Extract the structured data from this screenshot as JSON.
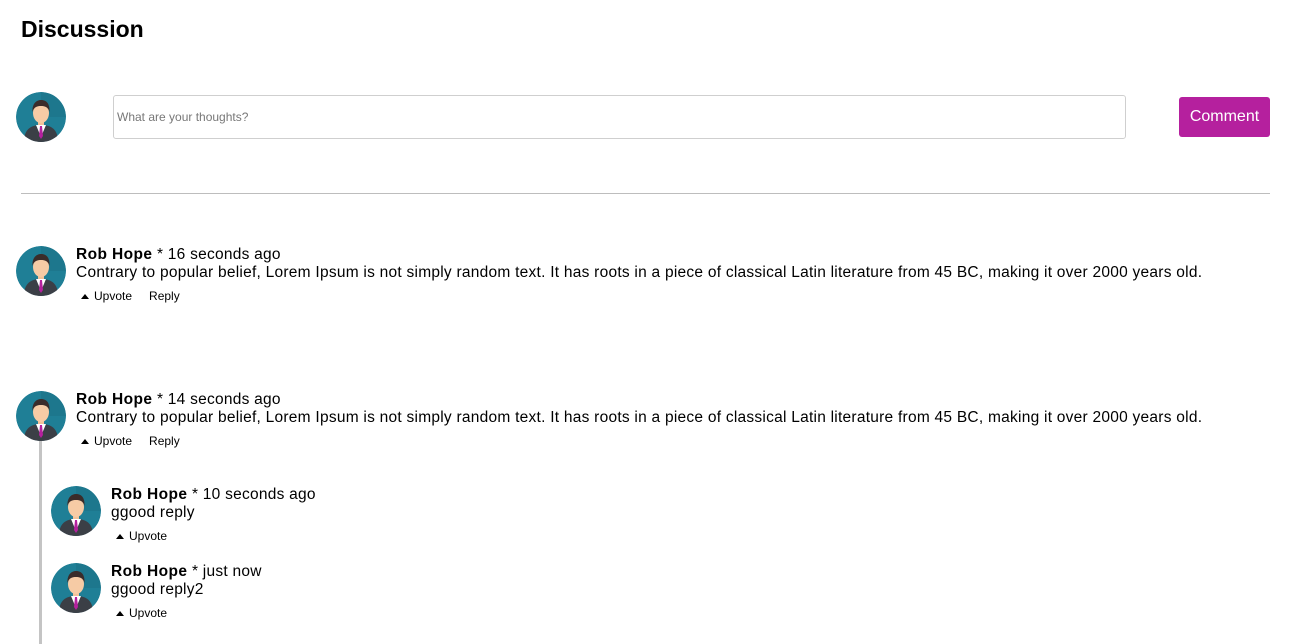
{
  "page": {
    "title": "Discussion"
  },
  "composer": {
    "avatar": "user-avatar",
    "placeholder": "What are your thoughts?",
    "value": "",
    "button_label": "Comment"
  },
  "colors": {
    "accent": "#b5209e",
    "thread_line": "#c4c4c4",
    "divider": "#bdbdbd"
  },
  "comments": [
    {
      "author": "Rob Hope",
      "separator": " * ",
      "time": "16 seconds ago",
      "text": "Contrary to popular belief, Lorem Ipsum is not simply random text. It has roots in a piece of classical Latin literature from 45 BC, making it over 2000 years old.",
      "upvote_label": "Upvote",
      "reply_label": "Reply"
    },
    {
      "author": "Rob Hope",
      "separator": " * ",
      "time": "14 seconds ago",
      "text": "Contrary to popular belief, Lorem Ipsum is not simply random text. It has roots in a piece of classical Latin literature from 45 BC, making it over 2000 years old.",
      "upvote_label": "Upvote",
      "reply_label": "Reply",
      "replies": [
        {
          "author": "Rob Hope",
          "separator": " * ",
          "time": "10 seconds ago",
          "text": "ggood reply",
          "upvote_label": "Upvote"
        },
        {
          "author": "Rob Hope",
          "separator": " * ",
          "time": "just now",
          "text": "ggood reply2",
          "upvote_label": "Upvote"
        }
      ]
    }
  ]
}
